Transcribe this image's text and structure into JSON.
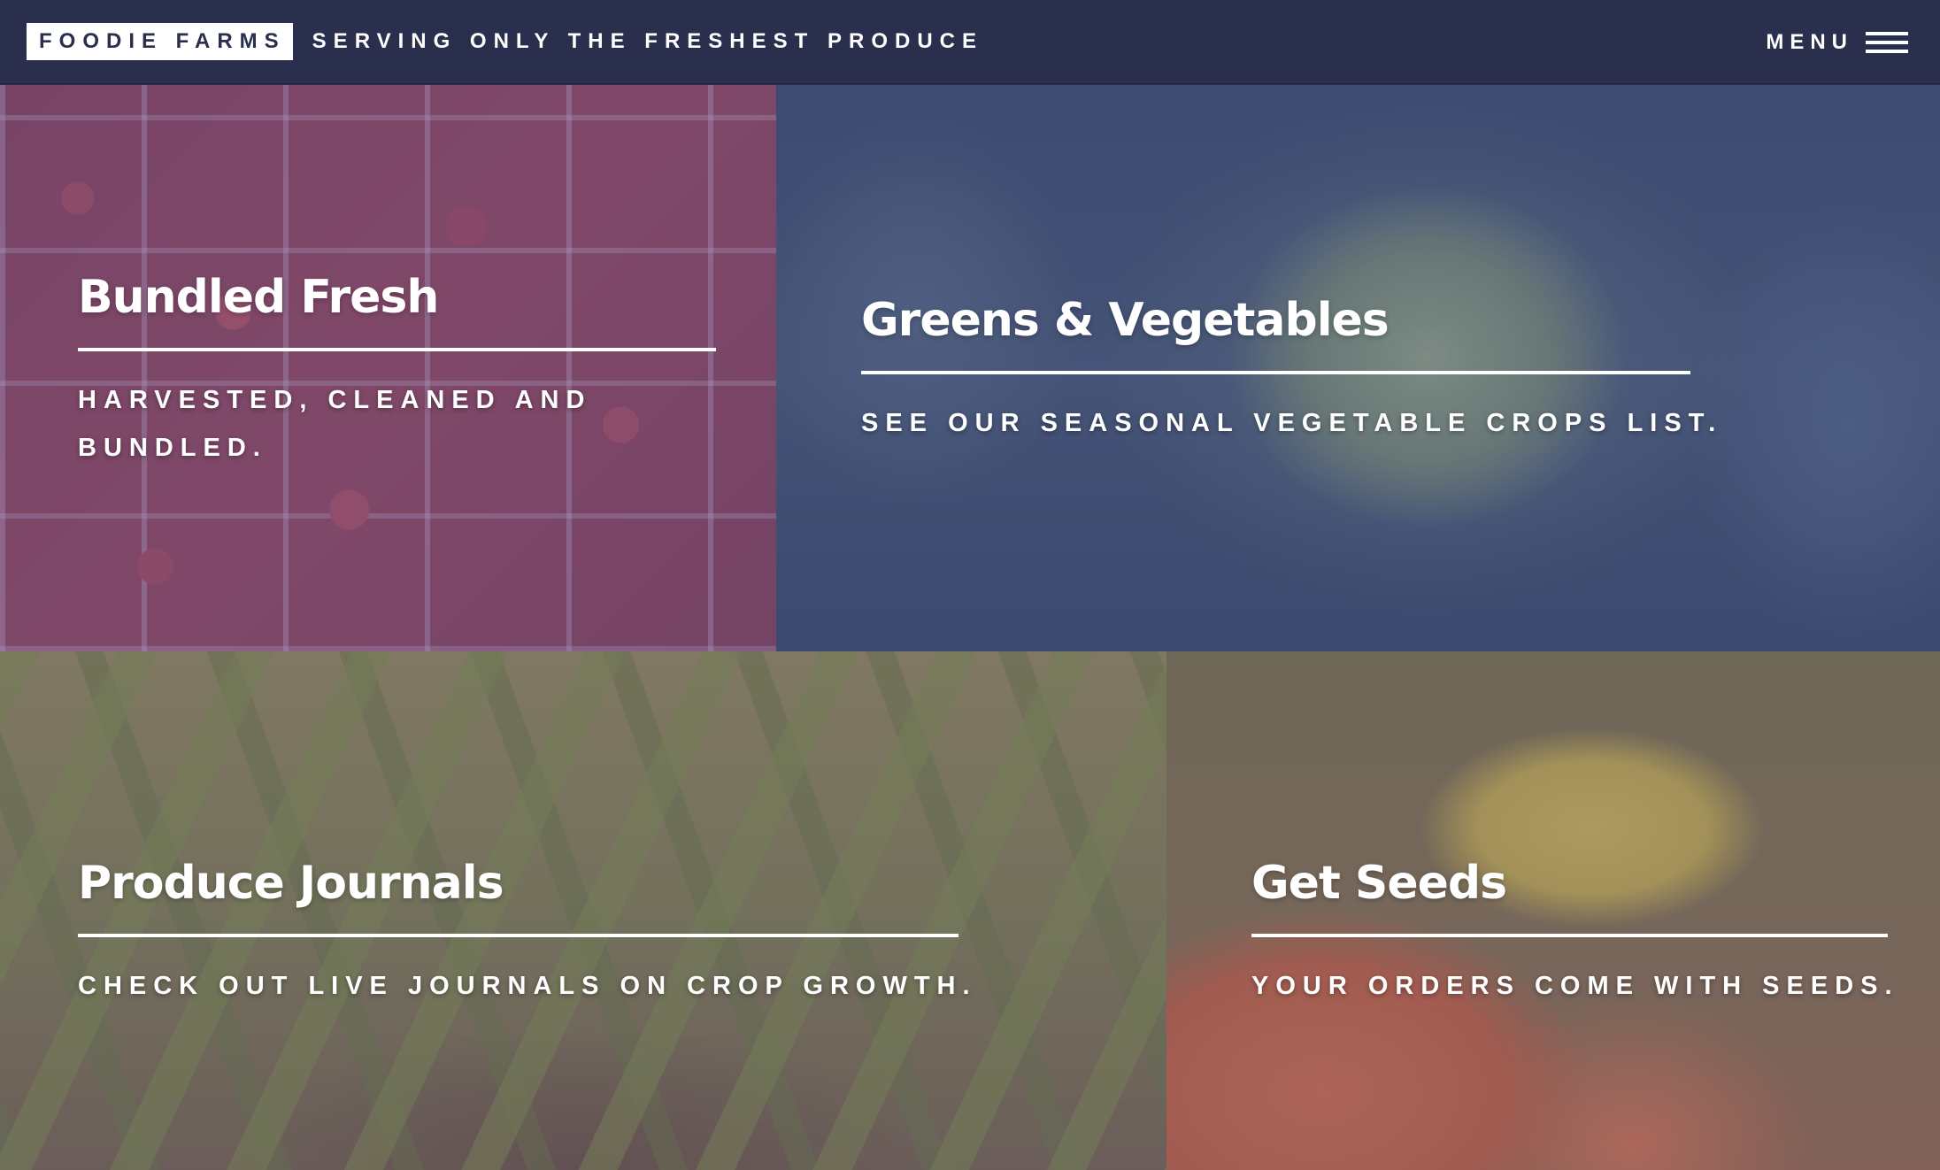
{
  "header": {
    "logo": "FOODIE FARMS",
    "tagline": "SERVING ONLY THE FRESHEST PRODUCE",
    "menu_label": "MENU",
    "menu_icon": "hamburger-icon",
    "background_color": "#2a2f4d"
  },
  "tiles": [
    {
      "title": "Bundled Fresh",
      "subtitle": "HARVESTED, CLEANED AND BUNDLED.",
      "image": "strawberries"
    },
    {
      "title": "Greens & Vegetables",
      "subtitle": "SEE OUR SEASONAL VEGETABLE CROPS LIST.",
      "image": "cabbage"
    },
    {
      "title": "Produce Journals",
      "subtitle": "CHECK OUT LIVE JOURNALS ON CROP GROWTH.",
      "image": "corn-plants"
    },
    {
      "title": "Get Seeds",
      "subtitle": "YOUR ORDERS COME WITH SEEDS.",
      "image": "tomatoes-and-peppers"
    }
  ]
}
